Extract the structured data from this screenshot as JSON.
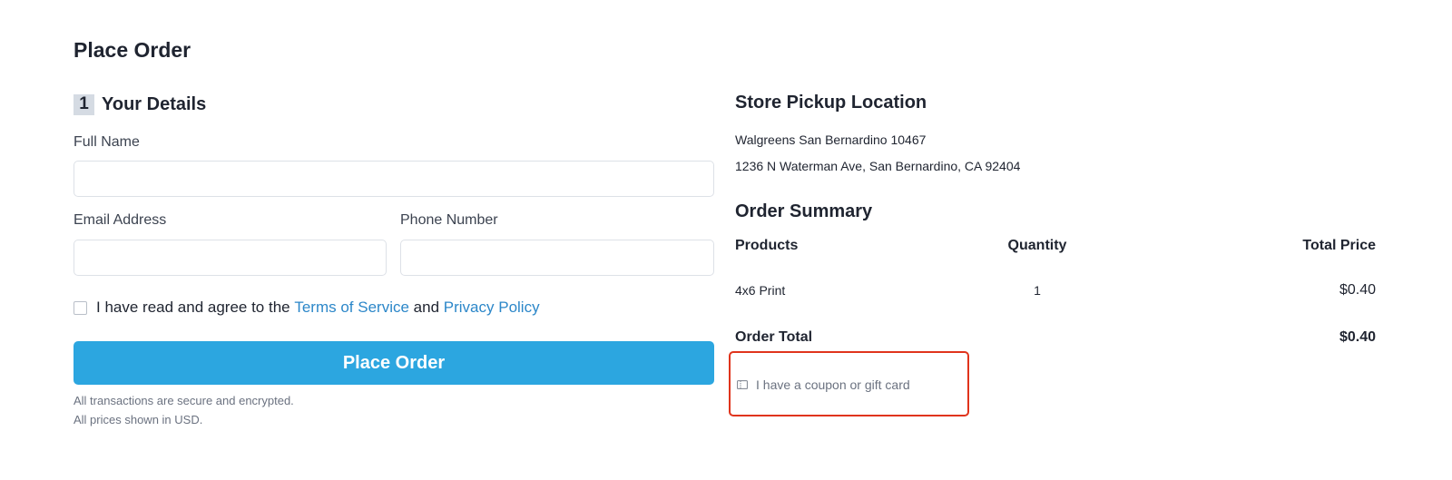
{
  "page": {
    "title": "Place Order"
  },
  "details": {
    "step_number": "1",
    "step_title": "Your Details",
    "full_name_label": "Full Name",
    "full_name_value": "",
    "email_label": "Email Address",
    "email_value": "",
    "phone_label": "Phone Number",
    "phone_value": "",
    "agree_prefix": "I have read and agree to the",
    "terms_link": "Terms of Service",
    "agree_and": "and",
    "privacy_link": "Privacy Policy",
    "agree_checked": false,
    "place_order_button": "Place Order",
    "note_secure": "All transactions are secure and encrypted.",
    "note_usd": "All prices shown in USD."
  },
  "pickup": {
    "title": "Store Pickup Location",
    "store_name": "Walgreens San Bernardino 10467",
    "store_address": "1236 N Waterman Ave, San Bernardino, CA 92404"
  },
  "summary": {
    "title": "Order Summary",
    "headers": {
      "products": "Products",
      "quantity": "Quantity",
      "total_price": "Total Price"
    },
    "rows": [
      {
        "product": "4x6 Print",
        "quantity": "1",
        "price": "$0.40"
      }
    ],
    "order_total_label": "Order Total",
    "order_total_value": "$0.40",
    "coupon_link": "I have a coupon or gift card"
  },
  "colors": {
    "primary_button": "#2ca6e0",
    "link": "#2c87c9",
    "highlight_border": "#e0341c"
  },
  "icons": {
    "coupon": "ticket-icon"
  }
}
